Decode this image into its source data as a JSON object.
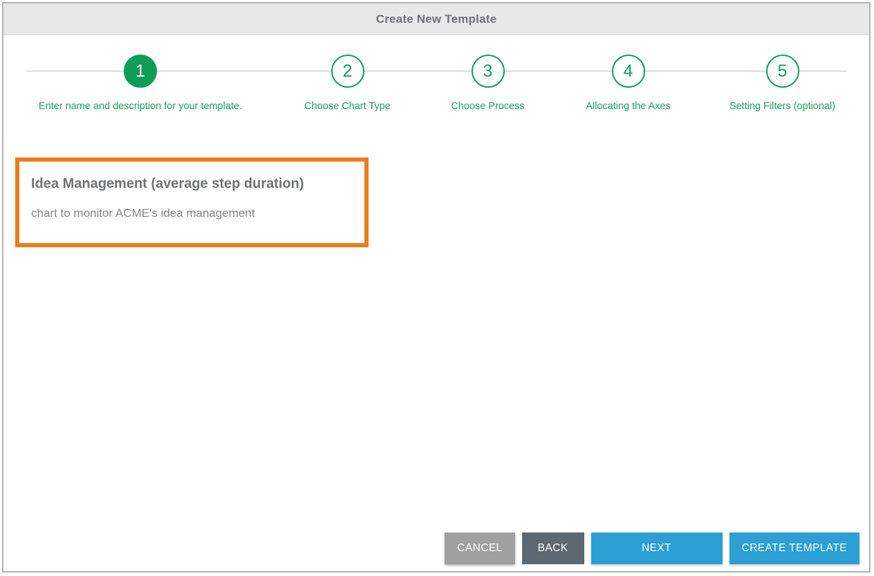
{
  "window": {
    "title": "Create New Template"
  },
  "stepper": {
    "active_index": 0,
    "accent_color": "#13a05e",
    "active_fill_color": "#0f9c56",
    "label_color": "#19a163",
    "steps": [
      {
        "number": "1",
        "label": "Enter name and description for your template."
      },
      {
        "number": "2",
        "label": "Choose Chart Type"
      },
      {
        "number": "3",
        "label": "Choose Process"
      },
      {
        "number": "4",
        "label": "Allocating the Axes"
      },
      {
        "number": "5",
        "label": "Setting Filters (optional)"
      }
    ]
  },
  "name_field": {
    "highlight_color": "#ea7d1c",
    "title_value": "Idea Management (average step duration)",
    "description_value": "chart to monitor ACME's idea management"
  },
  "footer": {
    "buttons": [
      {
        "label": "CANCEL",
        "color": "#a0a0a0"
      },
      {
        "label": "BACK",
        "color": "#5d6873"
      },
      {
        "label": "NEXT",
        "color": "#2c9fd4"
      },
      {
        "label": "CREATE TEMPLATE",
        "color": "#2c9fd4"
      }
    ]
  }
}
